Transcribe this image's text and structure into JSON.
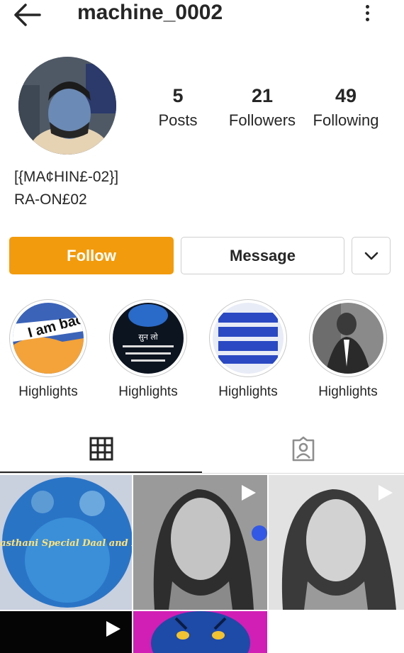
{
  "header": {
    "username": "machine_0002"
  },
  "stats": {
    "posts": {
      "count": "5",
      "label": "Posts"
    },
    "followers": {
      "count": "21",
      "label": "Followers"
    },
    "following": {
      "count": "49",
      "label": "Following"
    }
  },
  "bio": {
    "name": "[{MA¢HIN£-02}]",
    "text": "RA-ON£02"
  },
  "actions": {
    "follow_label": "Follow",
    "message_label": "Message"
  },
  "highlights": [
    {
      "label": "Highlights",
      "text": "I am back..."
    },
    {
      "label": "Highlights",
      "text": "सुन लो"
    },
    {
      "label": "Highlights"
    },
    {
      "label": "Highlights"
    }
  ],
  "grid_posts": [
    {
      "type": "image",
      "text": "Rajasthani Special Daal and Baati"
    },
    {
      "type": "video"
    },
    {
      "type": "video"
    },
    {
      "type": "video"
    },
    {
      "type": "image"
    }
  ],
  "colors": {
    "accent": "#f29b0c",
    "text": "#262626",
    "border": "#dbdbdb"
  }
}
